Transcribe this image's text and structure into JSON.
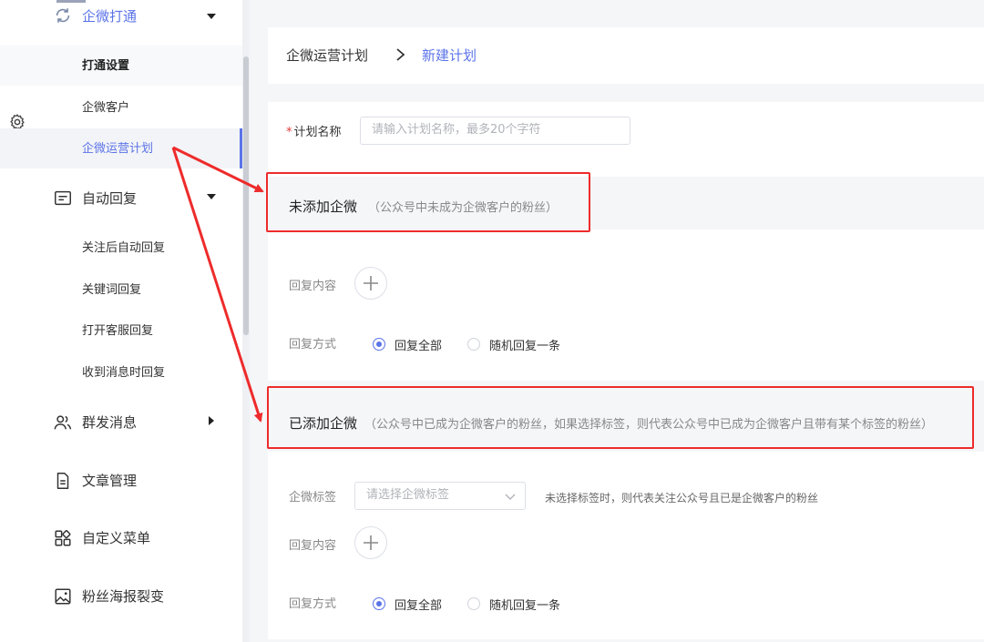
{
  "sidebar": {
    "group_qiwei": "企微打通",
    "sub_settings": "打通设置",
    "sub_customers": "企微客户",
    "sub_ops_plan": "企微运营计划",
    "group_autoreply": "自动回复",
    "sub_follow_reply": "关注后自动回复",
    "sub_keyword_reply": "关键词回复",
    "sub_service_reply": "打开客服回复",
    "sub_msg_reply": "收到消息时回复",
    "group_mass": "群发消息",
    "group_articles": "文章管理",
    "group_menu": "自定义菜单",
    "group_poster": "粉丝海报裂变"
  },
  "breadcrumb": {
    "parent": "企微运营计划",
    "current": "新建计划"
  },
  "form": {
    "required_mark": "*",
    "plan_name_label": "计划名称",
    "plan_name_placeholder": "请输入计划名称，最多20个字符",
    "section1": {
      "title": "未添加企微",
      "note": "（公众号中未成为企微客户的粉丝）",
      "content_label": "回复内容",
      "mode_label": "回复方式",
      "opt_all": "回复全部",
      "opt_random": "随机回复一条",
      "selected": "回复全部"
    },
    "section2": {
      "title": "已添加企微",
      "note": "（公众号中已成为企微客户的粉丝，如果选择标签，则代表公众号中已成为企微客户且带有某个标签的粉丝）",
      "tag_label": "企微标签",
      "tag_placeholder": "请选择企微标签",
      "tag_hint": "未选择标签时，则代表关注公众号且已是企微客户的粉丝",
      "content_label": "回复内容",
      "mode_label": "回复方式",
      "opt_all": "回复全部",
      "opt_random": "随机回复一条",
      "selected": "回复全部"
    }
  },
  "colors": {
    "accent": "#5b73e8",
    "annotation_red": "#ee2b2b"
  }
}
